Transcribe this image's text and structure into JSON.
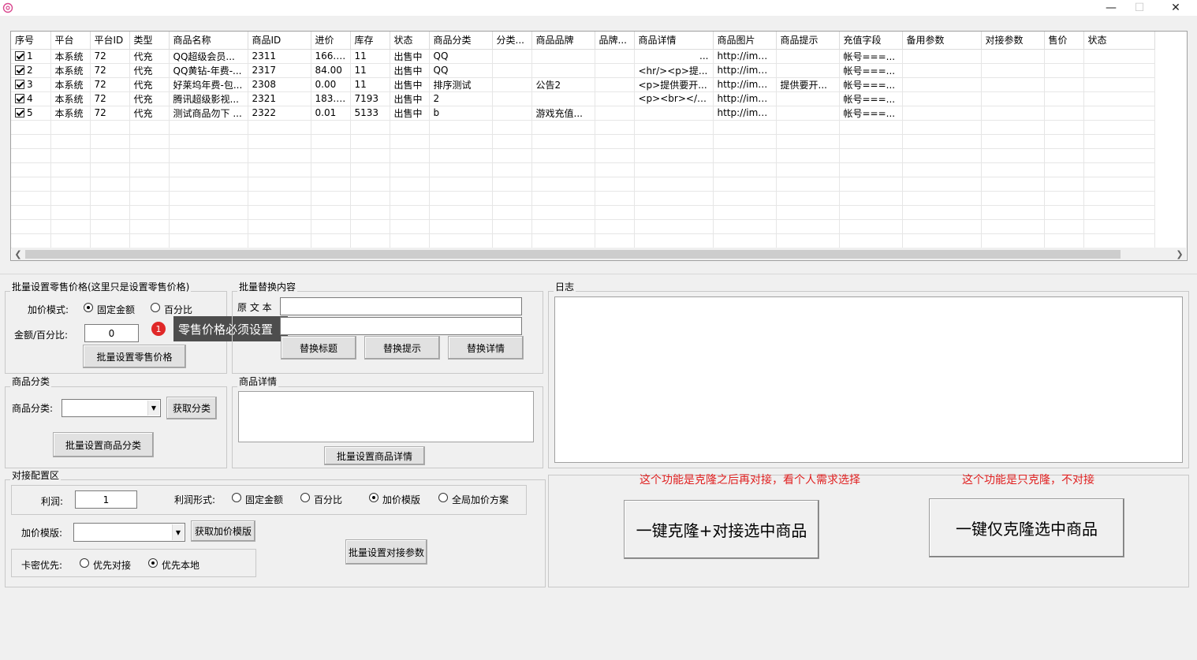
{
  "window": {
    "icon": "app-flower-icon",
    "controls": {
      "minimize": "—",
      "maximize": "☐",
      "close": "✕"
    }
  },
  "table": {
    "columns": [
      "序号",
      "平台",
      "平台ID",
      "类型",
      "商品名称",
      "商品ID",
      "进价",
      "库存",
      "状态",
      "商品分类",
      "分类...",
      "商品品牌",
      "品牌...",
      "商品详情",
      "商品图片",
      "商品提示",
      "充值字段",
      "备用参数",
      "对接参数",
      "售价",
      "状态"
    ],
    "rows": [
      [
        "1",
        "本系统",
        "72",
        "代充",
        "QQ超级会员...",
        "2311",
        "166.00",
        "11",
        "出售中",
        "QQ",
        "",
        "",
        "",
        "...",
        "http://img...",
        "",
        "帐号===...",
        "",
        "",
        "",
        ""
      ],
      [
        "2",
        "本系统",
        "72",
        "代充",
        "QQ黄钻-年费-...",
        "2317",
        "84.00",
        "11",
        "出售中",
        "QQ",
        "",
        "",
        "",
        "<hr/><p>提...",
        "http://img...",
        "",
        "帐号===...",
        "",
        "",
        "",
        ""
      ],
      [
        "3",
        "本系统",
        "72",
        "代充",
        "好莱坞年费-包...",
        "2308",
        "0.00",
        "11",
        "出售中",
        "排序测试",
        "",
        "公告2",
        "",
        "<p>提供要开...",
        "http://img...",
        "提供要开...",
        "帐号===...",
        "",
        "",
        "",
        ""
      ],
      [
        "4",
        "本系统",
        "72",
        "代充",
        "腾讯超级影视...",
        "2321",
        "183.00",
        "7193",
        "出售中",
        "2",
        "",
        "",
        "",
        "<p><br></p>",
        "http://img...",
        "",
        "帐号===...",
        "",
        "",
        "",
        ""
      ],
      [
        "5",
        "本系统",
        "72",
        "代充",
        "测试商品勿下 ...",
        "2322",
        "0.01",
        "5133",
        "出售中",
        "b",
        "",
        "游戏充值...",
        "",
        "",
        "http://img...",
        "",
        "帐号===...",
        "",
        "",
        "",
        ""
      ]
    ]
  },
  "retail": {
    "title": "批量设置零售价格(这里只是设置零售价格)",
    "mode_label": "加价模式:",
    "mode_fixed": "固定金额",
    "mode_percent": "百分比",
    "amount_label": "金额/百分比:",
    "amount_value": "0",
    "button": "批量设置零售价格",
    "tooltip_badge": "1",
    "tooltip": "零售价格必须设置"
  },
  "replace": {
    "title": "批量替换内容",
    "original_label": "原 文 本",
    "original_value": "",
    "replacement_value": "",
    "btn_title": "替换标题",
    "btn_hint": "替换提示",
    "btn_detail": "替换详情"
  },
  "log": {
    "title": "日志"
  },
  "category": {
    "title": "商品分类",
    "label": "商品分类:",
    "value": "",
    "get_button": "获取分类",
    "set_button": "批量设置商品分类"
  },
  "detail": {
    "title": "商品详情",
    "value": "",
    "button": "批量设置商品详情"
  },
  "docking": {
    "title": "对接配置区",
    "profit_label": "利润:",
    "profit_value": "1",
    "profit_form_label": "利润形式:",
    "opt_fixed": "固定金额",
    "opt_percent": "百分比",
    "opt_template": "加价模版",
    "opt_global": "全局加价方案",
    "template_label": "加价模版:",
    "template_value": "",
    "get_template_button": "获取加价模版",
    "card_label": "卡密优先:",
    "card_docking": "优先对接",
    "card_local": "优先本地",
    "set_button": "批量设置对接参数"
  },
  "clone": {
    "note_left": "这个功能是克隆之后再对接，看个人需求选择",
    "note_right": "这个功能是只克隆，不对接",
    "btn_clone_dock": "一键克隆+对接选中商品",
    "btn_clone_only": "一键仅克隆选中商品"
  },
  "colors": {
    "note_red": "#e02020",
    "tooltip_bg": "#4d4d4d",
    "badge_red": "#e02828"
  }
}
